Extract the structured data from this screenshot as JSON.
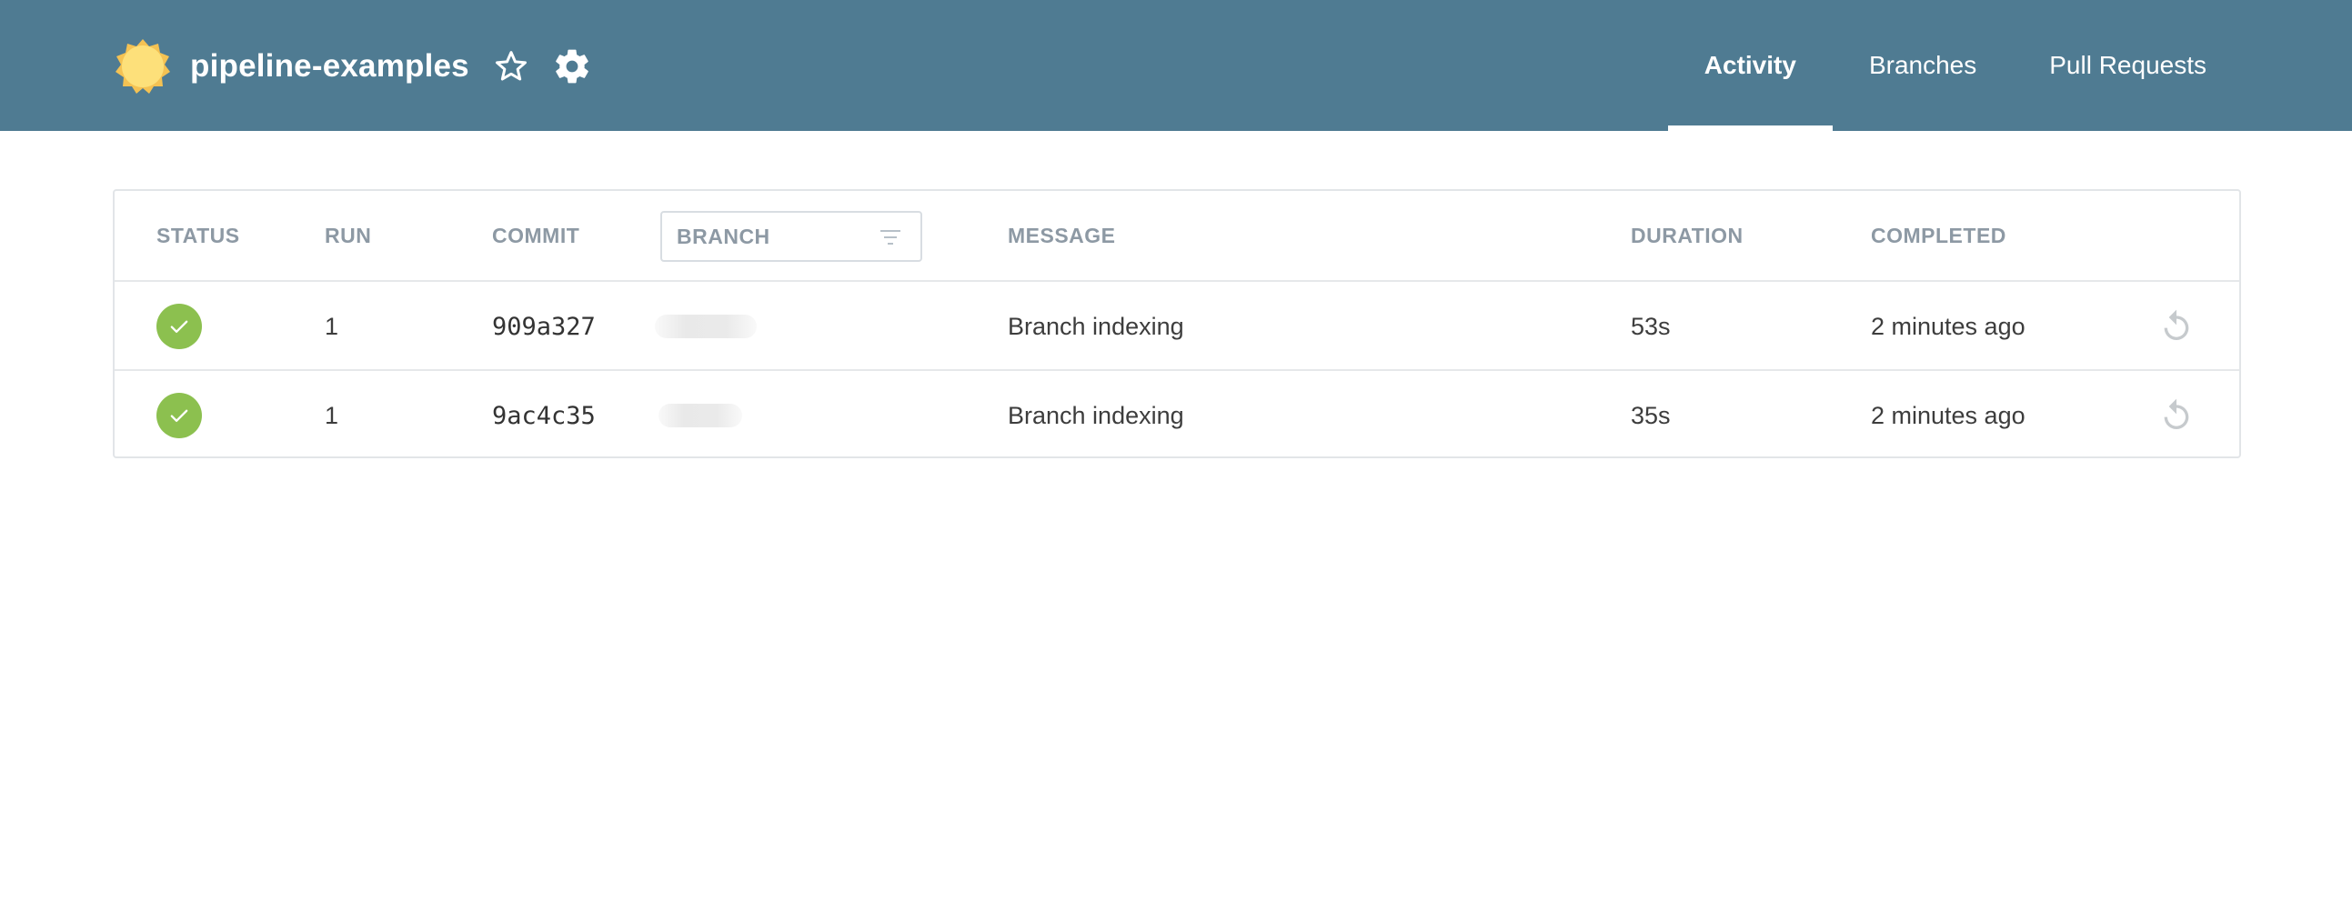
{
  "header": {
    "title": "pipeline-examples",
    "logo_icon": "jenkins-sun-logo-icon",
    "favorite_icon": "star-outline-icon",
    "settings_icon": "gear-icon",
    "colors": {
      "background": "#4f7b92",
      "text": "#ffffff"
    }
  },
  "nav": {
    "tabs": [
      {
        "label": "Activity",
        "active": true
      },
      {
        "label": "Branches",
        "active": false
      },
      {
        "label": "Pull Requests",
        "active": false
      }
    ]
  },
  "table": {
    "columns": {
      "status": "STATUS",
      "run": "RUN",
      "commit": "COMMIT",
      "branch": "BRANCH",
      "message": "MESSAGE",
      "duration": "DURATION",
      "completed": "COMPLETED"
    },
    "branch_filter_icon": "filter-icon",
    "rows": [
      {
        "status": "success",
        "status_icon": "check-icon",
        "run": "1",
        "commit": "909a327",
        "message": "Branch indexing",
        "duration": "53s",
        "completed": "2 minutes ago",
        "action_icon": "rerun-icon"
      },
      {
        "status": "success",
        "status_icon": "check-icon",
        "run": "1",
        "commit": "9ac4c35",
        "message": "Branch indexing",
        "duration": "35s",
        "completed": "2 minutes ago",
        "action_icon": "rerun-icon"
      }
    ],
    "colors": {
      "success": "#8cc04f",
      "header_text": "#8d99a4",
      "border": "#e2e5e8"
    }
  }
}
